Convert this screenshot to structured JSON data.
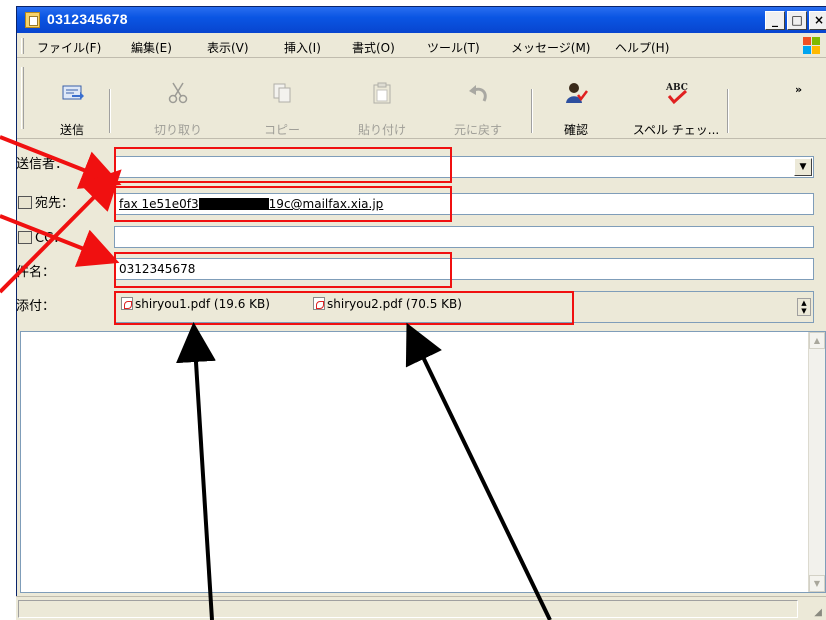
{
  "window": {
    "title": "0312345678"
  },
  "title_buttons": {
    "minimize": "_",
    "maximize": "□",
    "close": "×"
  },
  "menu": [
    "ファイル(F)",
    "編集(E)",
    "表示(V)",
    "挿入(I)",
    "書式(O)",
    "ツール(T)",
    "メッセージ(M)",
    "ヘルプ(H)"
  ],
  "toolbar": {
    "send": "送信",
    "cut": "切り取り",
    "copy": "コピー",
    "paste": "貼り付け",
    "undo": "元に戻す",
    "check": "確認",
    "spell": "スペル チェッ..."
  },
  "headers": {
    "from_label": "送信者：",
    "from_value": "",
    "to_label": "宛先：",
    "to_value_start": "fax 1e51e0f3",
    "to_value_end": "19c@mailfax.xia.jp",
    "cc_label": "CC：",
    "cc_value": "",
    "subject_label": "件名：",
    "subject_value": "0312345678",
    "attach_label": "添付："
  },
  "attachments": [
    {
      "name": "shiryou1.pdf",
      "size": "(19.6 KB)"
    },
    {
      "name": "shiryou2.pdf",
      "size": "(70.5 KB)"
    }
  ],
  "colors": {
    "titlebar": "#0a55e3",
    "annotation_red": "#f01010",
    "annotation_black": "#000000"
  }
}
